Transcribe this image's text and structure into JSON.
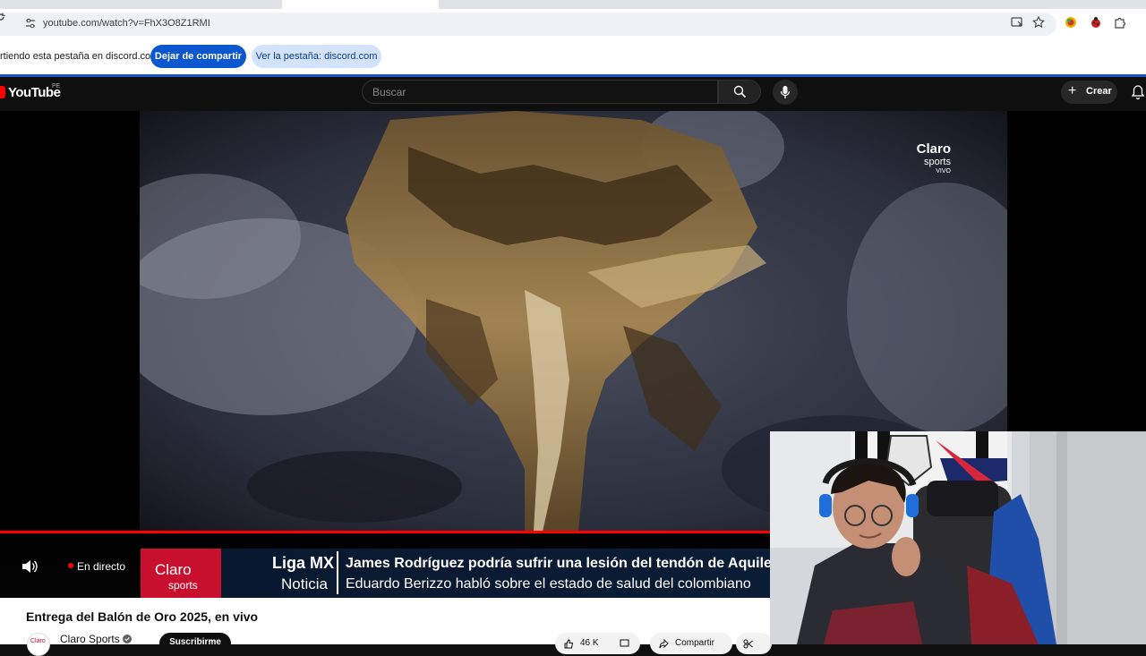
{
  "browser": {
    "url": "youtube.com/watch?v=FhX3O8Z1RMI"
  },
  "sharing_bar": {
    "message": "rtiendo esta pestaña en discord.com",
    "stop_button": "Dejar de compartir",
    "view_tab_button": "Ver la pestaña: discord.com"
  },
  "youtube_header": {
    "logo": "YouTube",
    "country": "PE",
    "search_placeholder": "Buscar",
    "create_label": "Crear"
  },
  "player": {
    "watermark": {
      "line1": "Claro",
      "line2": "sports",
      "line3": "VIVO"
    },
    "live_label": "En directo",
    "lower_third": {
      "logo_line1": "Claro",
      "logo_line2": "sports",
      "category": "Liga MX",
      "subcategory": "Noticia",
      "headline": "James Rodríguez podría sufrir una lesión del tendón de Aquiles",
      "subheadline": "Eduardo Berizzo habló sobre el estado de salud del colombiano"
    }
  },
  "video": {
    "title": "Entrega del Balón de Oro 2025, en vivo",
    "channel": "Claro Sports",
    "channel_avatar_text": "Claro",
    "subscribe_label": "Suscribirme",
    "likes": "46 K",
    "share_label": "Compartir"
  },
  "colors": {
    "youtube_red": "#ff0000",
    "claro_red": "#c8102e",
    "share_blue": "#0b57d0"
  }
}
